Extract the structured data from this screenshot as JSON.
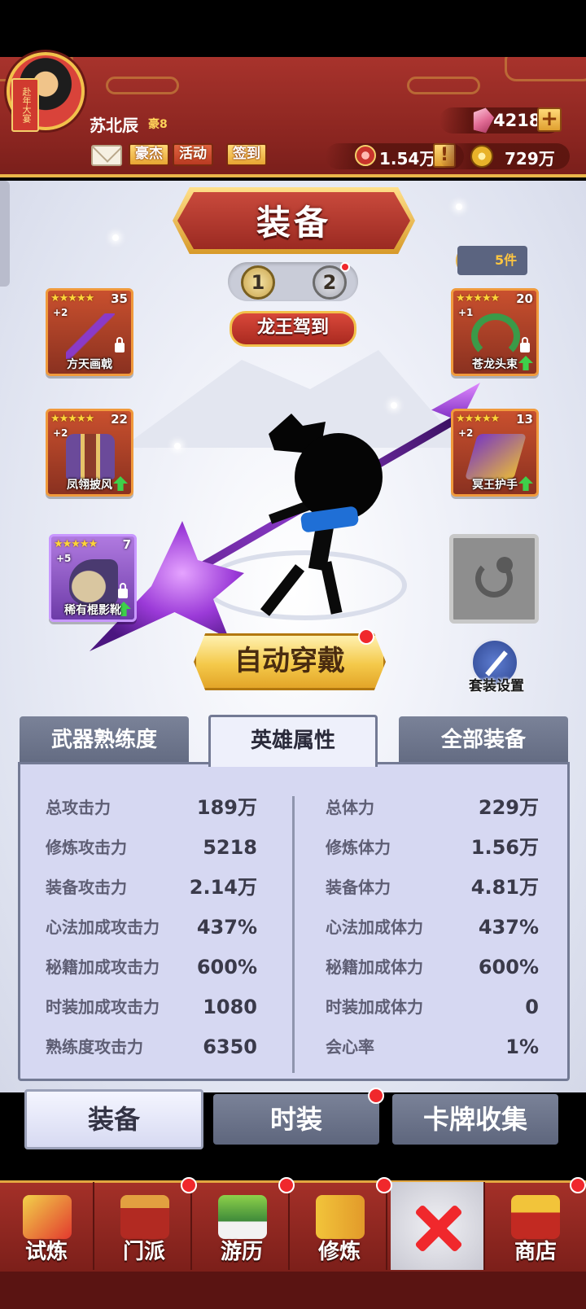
{
  "header": {
    "player_name": "苏北辰",
    "player_rank": "豪8",
    "buttons": [
      "豪杰",
      "活动",
      "签到"
    ],
    "gems": "4218",
    "tokens": "1.54万",
    "coins": "729万",
    "avatar_scroll_text": "赴年大宴",
    "add_label": "+",
    "alert_label": "!"
  },
  "title": "装备",
  "page_switch": [
    "1",
    "2"
  ],
  "set_count": "5件",
  "set_name": "龙王驾到",
  "slots": [
    {
      "name": "方天画戟",
      "stars": "★★★★★",
      "level": "35",
      "plus": "+2"
    },
    {
      "name": "苍龙头束",
      "stars": "★★★★★",
      "level": "20",
      "plus": "+1"
    },
    {
      "name": "凤翎披风",
      "stars": "★★★★★",
      "level": "22",
      "plus": "+2"
    },
    {
      "name": "冥王护手",
      "stars": "★★★★★",
      "level": "13",
      "plus": "+2"
    },
    {
      "name": "稀有棍影靴",
      "stars": "★★★★★",
      "level": "7",
      "plus": "+5"
    }
  ],
  "auto_equip": "自动穿戴",
  "set_settings": "套装设置",
  "stat_tabs": [
    "武器熟练度",
    "英雄属性",
    "全部装备"
  ],
  "stats_left": [
    {
      "label": "总攻击力",
      "value": "189万"
    },
    {
      "label": "修炼攻击力",
      "value": "5218"
    },
    {
      "label": "装备攻击力",
      "value": "2.14万"
    },
    {
      "label": "心法加成攻击力",
      "value": "437%"
    },
    {
      "label": "秘籍加成攻击力",
      "value": "600%"
    },
    {
      "label": "时装加成攻击力",
      "value": "1080"
    },
    {
      "label": "熟练度攻击力",
      "value": "6350"
    }
  ],
  "stats_right": [
    {
      "label": "总体力",
      "value": "229万"
    },
    {
      "label": "修炼体力",
      "value": "1.56万"
    },
    {
      "label": "装备体力",
      "value": "4.81万"
    },
    {
      "label": "心法加成体力",
      "value": "437%"
    },
    {
      "label": "秘籍加成体力",
      "value": "600%"
    },
    {
      "label": "时装加成体力",
      "value": "0"
    },
    {
      "label": "会心率",
      "value": "1%"
    }
  ],
  "sub_tabs": [
    "装备",
    "时装",
    "卡牌收集"
  ],
  "nav": [
    "试炼",
    "门派",
    "游历",
    "修炼",
    "商店"
  ],
  "colors": {
    "accent_red": "#a8332c",
    "gold": "#f2c14b",
    "panel": "#d6d8f2"
  }
}
